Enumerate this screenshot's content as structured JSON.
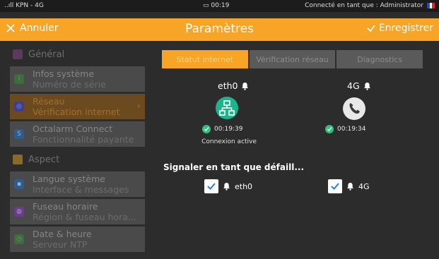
{
  "statusbar": {
    "signal": "..ıll KPN - 4G",
    "clock": "00:19",
    "user": "Connecté en tant que : Administrator"
  },
  "header": {
    "cancel_label": "Annuler",
    "title": "Paramètres",
    "save_label": "Enregistrer"
  },
  "sidebar": {
    "general_section": "Général",
    "aspect_section": "Aspect",
    "items": [
      {
        "title": "Infos système",
        "subtitle": "Numéro de série"
      },
      {
        "title": "Réseau",
        "subtitle": "Vérification internet"
      },
      {
        "title": "Octalarm Connect",
        "subtitle": "Fonctionnalité payante"
      },
      {
        "title": "Langue système",
        "subtitle": "Interface & messages"
      },
      {
        "title": "Fuseau horaire",
        "subtitle": "Région & fuseau hora..."
      },
      {
        "title": "Date & heure",
        "subtitle": "Serveur NTP"
      }
    ]
  },
  "tabs": [
    {
      "label": "Statut internet"
    },
    {
      "label": "Vérification réseau"
    },
    {
      "label": "Diagnostics"
    }
  ],
  "interfaces": {
    "eth0": {
      "name": "eth0",
      "time": "00:19:39",
      "status": "Connexion active"
    },
    "g4": {
      "name": "4G",
      "time": "00:19:34"
    }
  },
  "report": {
    "title": "Signaler en tant que défaill...",
    "eth0": "eth0",
    "g4": "4G"
  },
  "colors": {
    "accent": "#f7a427",
    "ok": "#2ec27e",
    "eth": "#1db38c"
  }
}
